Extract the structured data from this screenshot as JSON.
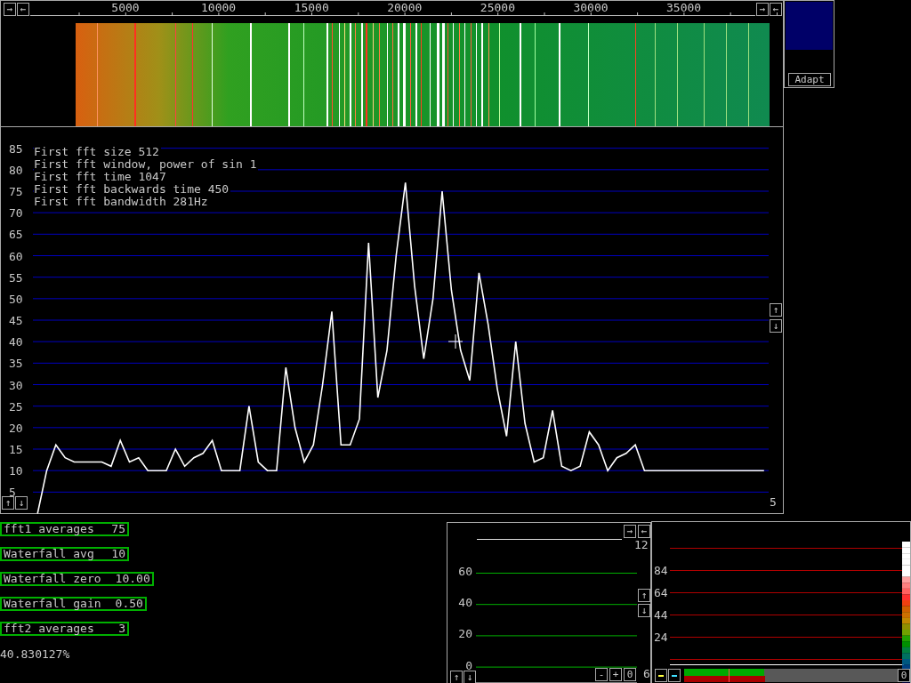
{
  "waterfall": {
    "scroll_buttons": [
      "→",
      "←",
      "→",
      "←"
    ],
    "frequency_labels": [
      "5000",
      "10000",
      "15000",
      "20000",
      "25000",
      "30000",
      "35000"
    ]
  },
  "gain_panel": {
    "button": "Adapt"
  },
  "spectrum": {
    "info_lines": [
      "First fft size 512",
      "First fft window, power of sin 1",
      "First fft time 1047",
      "First fft backwards time 450",
      "First fft bandwidth 281Hz"
    ],
    "side_buttons": [
      "↑",
      "↓"
    ],
    "corner_buttons": [
      "↑",
      "↓"
    ],
    "readout": "5",
    "chart_data": {
      "type": "line",
      "categories": [
        null,
        null,
        null,
        null,
        null,
        null,
        null,
        null,
        null,
        null,
        null,
        null,
        null,
        null,
        null,
        null,
        null,
        null,
        null,
        null,
        null,
        null,
        null,
        null,
        null,
        null,
        null,
        null,
        null,
        null,
        null,
        null,
        null,
        null,
        null,
        null,
        null,
        null,
        null,
        null,
        null,
        null,
        null,
        null,
        null,
        null,
        null,
        null,
        null,
        null,
        null,
        null,
        null,
        null,
        null,
        null,
        null,
        null,
        null,
        null,
        null,
        null,
        null,
        null,
        null,
        null,
        null,
        null,
        null,
        null,
        null,
        null,
        null,
        null,
        null,
        null,
        null,
        null,
        null,
        null
      ],
      "grid": true,
      "ylim": [
        0,
        90
      ],
      "yticks": [
        5,
        10,
        15,
        20,
        25,
        30,
        35,
        40,
        45,
        50,
        55,
        60,
        65,
        70,
        75,
        80,
        85
      ],
      "series": [
        {
          "color": "#ffffff",
          "values": [
            0,
            10,
            16,
            13,
            12,
            12,
            12,
            12,
            11,
            17,
            12,
            13,
            10,
            10,
            10,
            15,
            11,
            13,
            14,
            17,
            10,
            10,
            10,
            25,
            12,
            10,
            10,
            34,
            20,
            12,
            16,
            30,
            47,
            16,
            16,
            22,
            63,
            27,
            38,
            60,
            77,
            53,
            36,
            50,
            75,
            52,
            38,
            31,
            56,
            44,
            29,
            18,
            40,
            21,
            12,
            13,
            24,
            11,
            10,
            11,
            19,
            16,
            10,
            13,
            14,
            16,
            10,
            10,
            10,
            10,
            10,
            10,
            10,
            10,
            10,
            10,
            10,
            10,
            10,
            10
          ]
        }
      ]
    }
  },
  "parameters": [
    {
      "label": "fft1 averages",
      "value": "75"
    },
    {
      "label": "Waterfall avg",
      "value": "10"
    },
    {
      "label": "Waterfall zero",
      "value": "10.00"
    },
    {
      "label": "Waterfall gain",
      "value": "0.50"
    },
    {
      "label": "fft2 averages",
      "value": "3"
    }
  ],
  "percentage": "40.830127%",
  "baseband_panel": {
    "top_buttons": [
      "→",
      "←"
    ],
    "top_readout": "12",
    "y_labels": [
      "60",
      "40",
      "20",
      "0"
    ],
    "side_buttons": [
      "↑",
      "↓"
    ],
    "corner_buttons": [
      "↑",
      "↓"
    ],
    "zoom_buttons": [
      "-",
      "+",
      "0"
    ],
    "bottom_readout": "6"
  },
  "meter_panel": {
    "y_labels": [
      "84",
      "64",
      "44",
      "24"
    ],
    "buttons": [
      {
        "color": "#ffff40"
      },
      {
        "color": "#40e0ff"
      }
    ],
    "reset_button": "0",
    "bars": [
      {
        "kind": "bar",
        "level": 0.375,
        "color": "#00aa00"
      },
      {
        "kind": "bar",
        "level": 0.38,
        "color": "#aa0000"
      },
      {
        "kind": "marker",
        "level": 0.21,
        "color": "#ff5050"
      }
    ]
  }
}
